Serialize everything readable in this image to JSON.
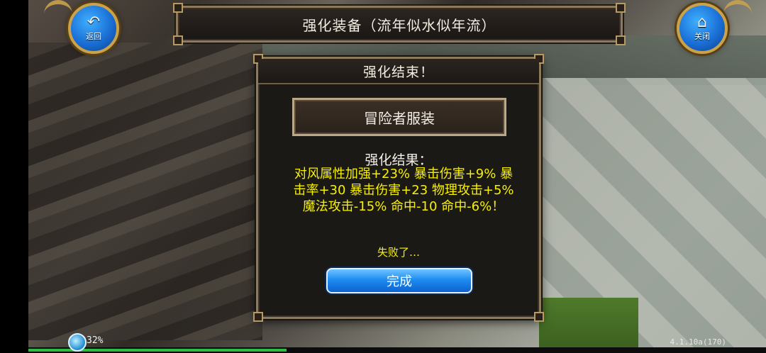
{
  "window": {
    "title": "强化装备（流年似水似年流）"
  },
  "nav": {
    "back_label": "返回",
    "close_label": "关闭",
    "back_icon": "return-arrow-icon",
    "close_icon": "home-icon"
  },
  "dialog": {
    "header": "强化结束！",
    "item_name": "冒险者服装",
    "result_label": "强化结果：",
    "result_lines": [
      "对风属性加强+23% 暴击伤害+9% 暴",
      "击率+30 暴击伤害+23 物理攻击+5%",
      "魔法攻击-15% 命中-10 命中-6%！"
    ],
    "fail_text": "失败了…",
    "done_label": "完成"
  },
  "status": {
    "percent": "32%",
    "version": "4.1.10a(170)",
    "progress": 0.35
  },
  "colors": {
    "accent_gold": "#c9a24a",
    "result_yellow": "#f7f000",
    "button_blue": "#1f8df2"
  }
}
